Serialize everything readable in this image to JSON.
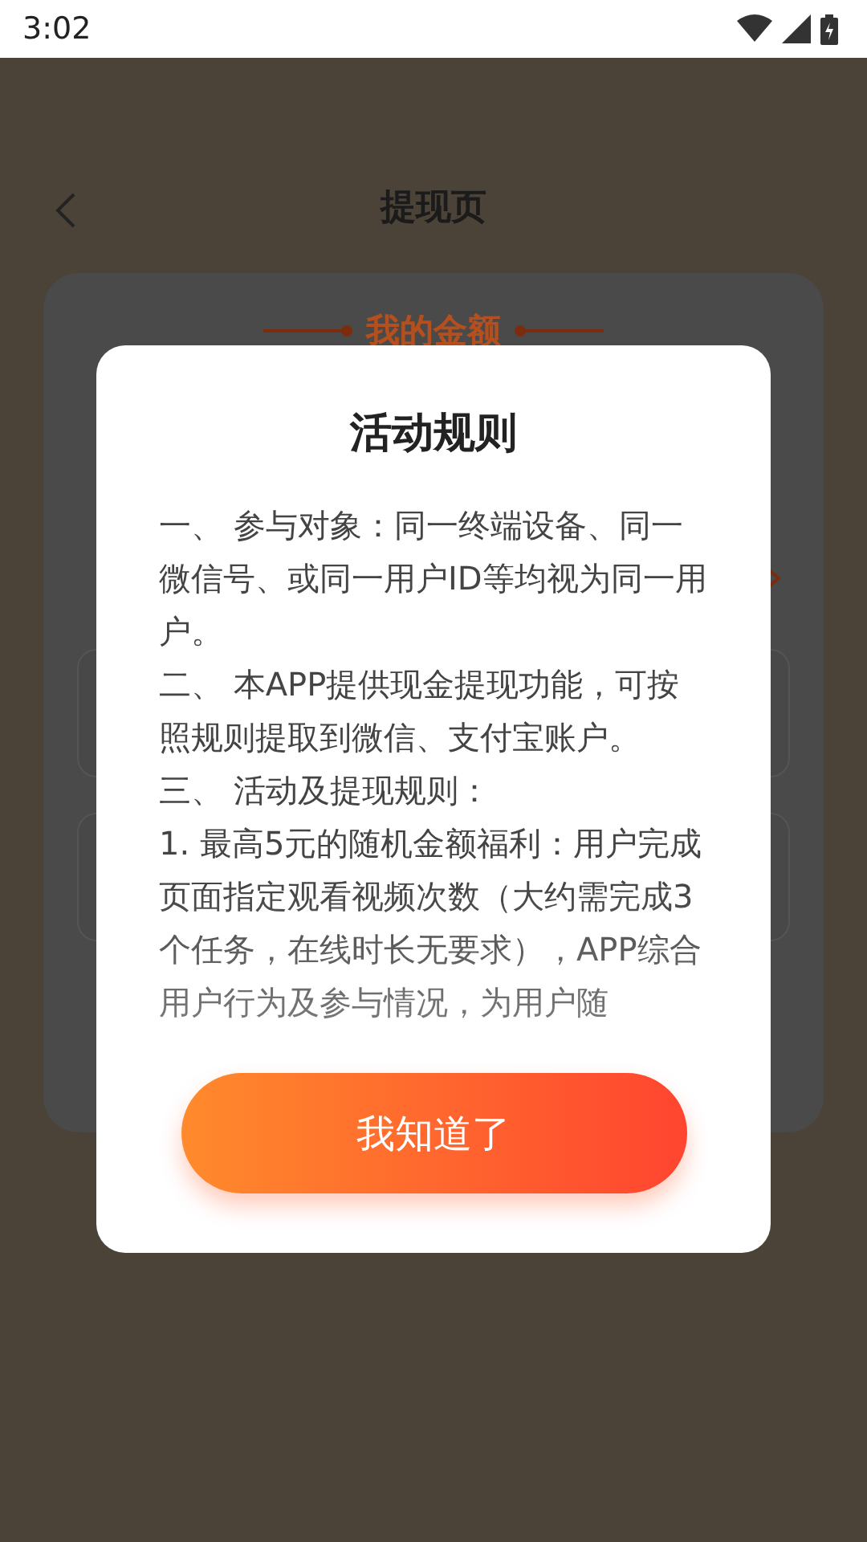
{
  "status_bar": {
    "time": "3:02"
  },
  "page": {
    "title": "提现页",
    "card_heading": "我的金额"
  },
  "dialog": {
    "title": "活动规则",
    "paragraphs": [
      "一、 参与对象：同一终端设备、同一微信号、或同一用户ID等均视为同一用户。",
      "二、 本APP提供现金提现功能，可按照规则提取到微信、支付宝账户。",
      "三、 活动及提现规则：",
      "1. 最高5元的随机金额福利：用户完成页面指定观看视频次数（大约需完成3个任务，在线时长无要求），APP综合用户行为及参与情况，为用户随"
    ],
    "button": "我知道了"
  }
}
